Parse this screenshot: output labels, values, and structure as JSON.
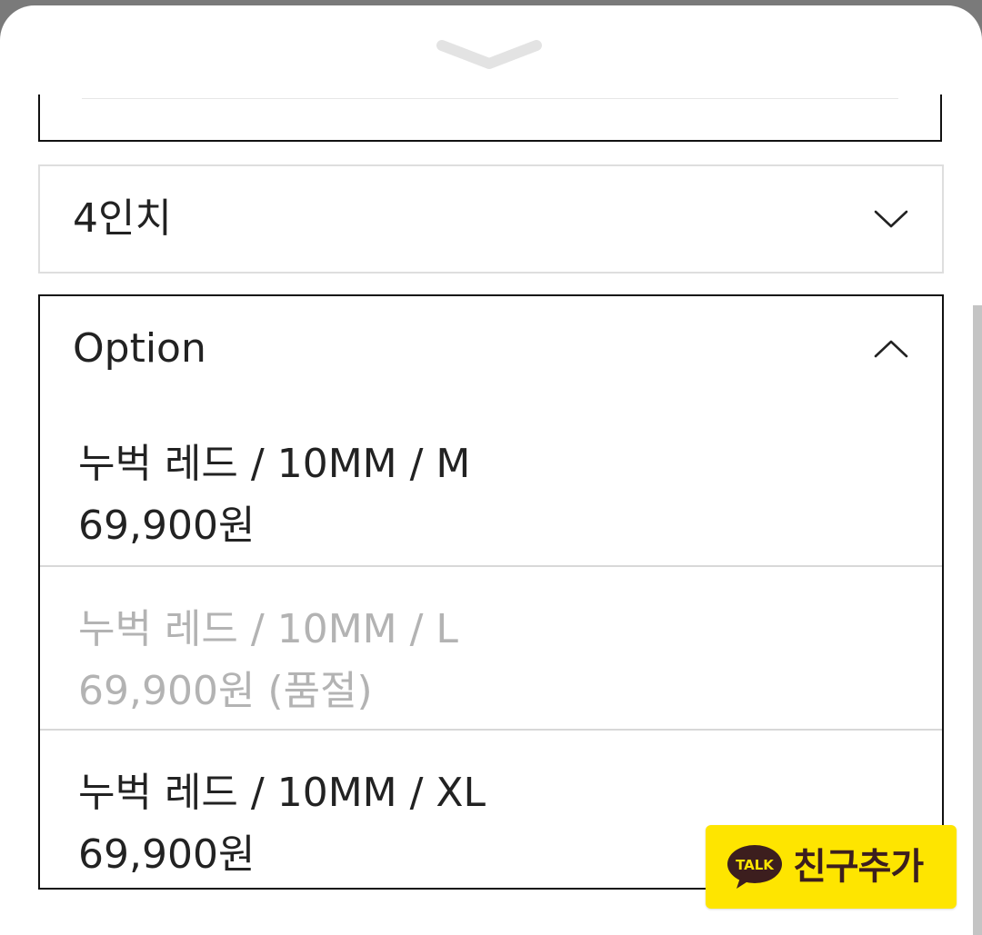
{
  "colors": {
    "accent_border": "#111111",
    "muted_border": "#dedede",
    "disabled_text": "#b3b3b3",
    "kakao_yellow": "#fee500",
    "kakao_brown": "#3c1e1e"
  },
  "sheet": {
    "handle_icon": "chevron-down-icon"
  },
  "size_select": {
    "value": "4인치",
    "icon": "chevron-down-icon"
  },
  "option_select": {
    "placeholder": "Option",
    "icon": "chevron-up-icon",
    "options": [
      {
        "name": "누벅 레드 / 10MM / M",
        "price": "69,900원",
        "sold_out": false
      },
      {
        "name": "누벅 레드 / 10MM / L",
        "price": "69,900원 (품절)",
        "sold_out": true
      },
      {
        "name": "누벅 레드 / 10MM / XL",
        "price": "69,900원",
        "sold_out": false
      }
    ]
  },
  "kakao_button": {
    "icon_text": "TALK",
    "label": "친구추가"
  }
}
